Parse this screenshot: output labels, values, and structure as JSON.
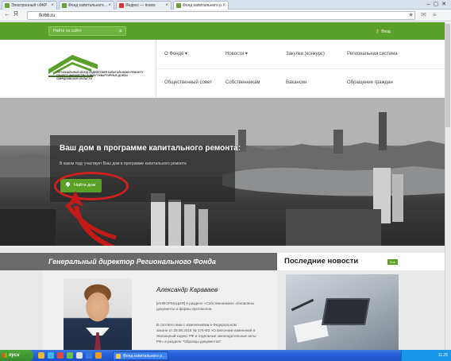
{
  "browser": {
    "tabs": [
      {
        "label": "Электронный г.ФКР"
      },
      {
        "label": "Фонд капитального…"
      },
      {
        "label": "Яндекс — поиск"
      },
      {
        "label": "Фонд капитального р…"
      }
    ],
    "url": "fkr66.ru"
  },
  "site": {
    "search_placeholder": "Найти на сайте",
    "login_label": "Вход",
    "logo_text": "Региональный фонд содействия капитальному ремонту общего имущества в многоквартирных домах Свердловской области",
    "menu": [
      {
        "label": "О Фонде ▾"
      },
      {
        "label": "Новости ▾"
      },
      {
        "label": "Закупки (конкурс)"
      },
      {
        "label": "Региональная система"
      },
      {
        "label": "Общественный совет"
      },
      {
        "label": "Собственникам"
      },
      {
        "label": "Вакансии"
      },
      {
        "label": "Обращение граждан"
      }
    ],
    "hero": {
      "title": "Ваш дом в программе капитального ремонта:",
      "subtitle": "В каком году участвует Ваш дом в программе капитального ремонта",
      "button_label": "Найти дом"
    },
    "director": {
      "heading": "Генеральный директор Регионального Фонда",
      "name": "Александр Караваев",
      "paragraphs": [
        "[ИНФОРМАЦИЯ] в разделе «Собственникам» обновлены",
        "документы и формы протоколов.",
        "В соответствии с изменениями в Федеральном",
        "законе от 29.06.2015 № 176-ФЗ «О внесении изменений в",
        "Жилищный кодекс РФ и отдельные законодательные акты",
        "РФ» в разделе \"Образцы документов\""
      ]
    },
    "news": {
      "heading": "Последние новости",
      "all_label": "Все"
    }
  },
  "taskbar": {
    "start_label": "пуск",
    "windows": [
      {
        "label": "Фонд капитального р…"
      }
    ],
    "clock": "11:25"
  }
}
